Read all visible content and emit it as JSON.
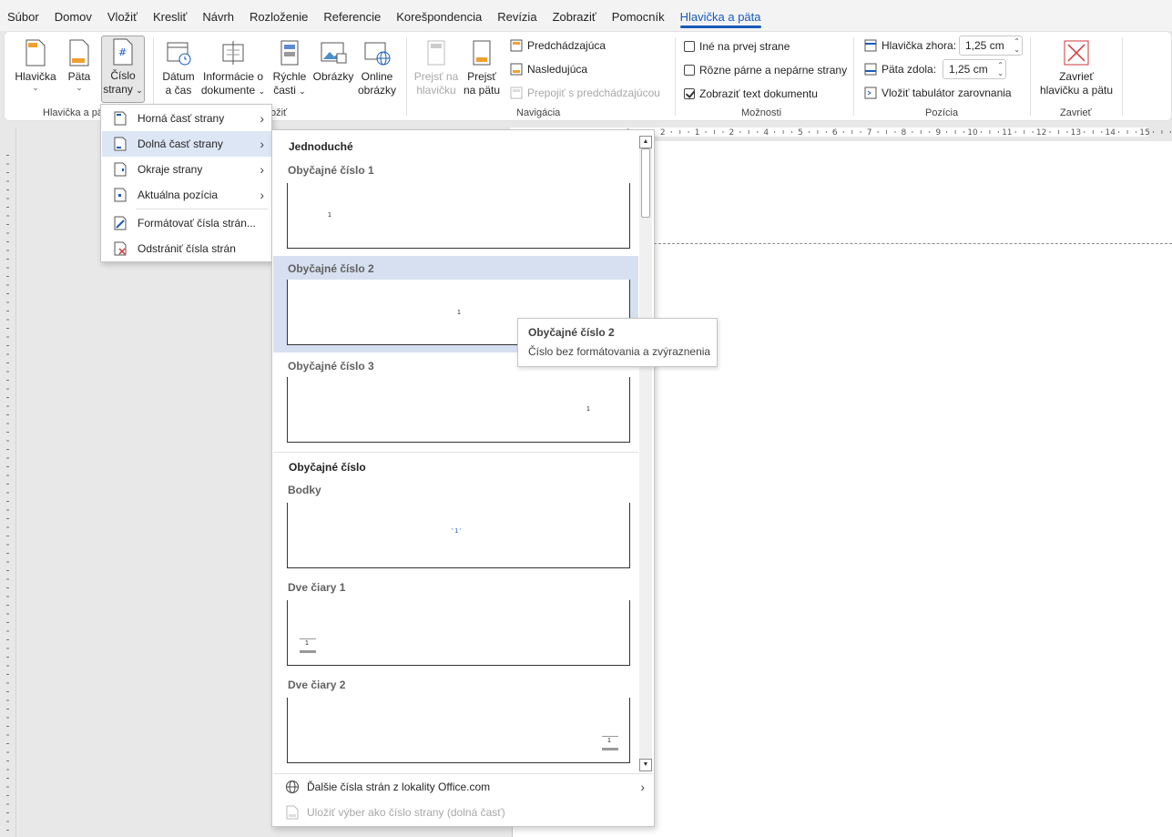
{
  "tabs": [
    "Súbor",
    "Domov",
    "Vložiť",
    "Kresliť",
    "Návrh",
    "Rozloženie",
    "Referencie",
    "Korešpondencia",
    "Revízia",
    "Zobraziť",
    "Pomocník",
    "Hlavička a päta"
  ],
  "ribbon": {
    "header_footer": {
      "group_label": "Hlavička a pä",
      "header_line1": "Hlavička",
      "footer_line1": "Päta",
      "page_number_line1": "Číslo",
      "page_number_line2": "strany"
    },
    "insert": {
      "group_label": "ožiť",
      "date_line1": "Dátum",
      "date_line2": "a čas",
      "docinfo_line1": "Informácie o",
      "docinfo_line2": "dokumente",
      "quick_line1": "Rýchle",
      "quick_line2": "časti",
      "pictures": "Obrázky",
      "online_line1": "Online",
      "online_line2": "obrázky"
    },
    "navigation": {
      "group_label": "Navigácia",
      "goto_header_line1": "Prejsť na",
      "goto_header_line2": "hlavičku",
      "goto_footer_line1": "Prejsť",
      "goto_footer_line2": "na pätu",
      "previous": "Predchádzajúca",
      "next": "Nasledujúca",
      "link_previous": "Prepojiť s predchádzajúcou"
    },
    "options": {
      "group_label": "Možnosti",
      "first_page": "Iné na prvej strane",
      "odd_even": "Rôzne párne a nepárne strany",
      "show_text": "Zobraziť text dokumentu"
    },
    "position": {
      "group_label": "Pozícia",
      "header_top_label": "Hlavička zhora:",
      "header_top_value": "1,25 cm",
      "footer_bottom_label": "Päta zdola:",
      "footer_bottom_value": "1,25 cm",
      "insert_tab": "Vložiť tabulátor zarovnania"
    },
    "close": {
      "group_label": "Zavrieť",
      "close_line1": "Zavrieť",
      "close_line2": "hlavičku a pätu"
    }
  },
  "ruler": [
    "1",
    "2",
    "1",
    "2",
    "4",
    "5",
    "6",
    "7",
    "8",
    "9",
    "10",
    "11",
    "12",
    "13",
    "14",
    "15"
  ],
  "page_number_menu": [
    {
      "label": "Horná časť strany"
    },
    {
      "label": "Dolná časť strany"
    },
    {
      "label": "Okraje strany"
    },
    {
      "label": "Aktuálna pozícia"
    },
    {
      "label": "Formátovať čísla strán..."
    },
    {
      "label": "Odstrániť čísla strán"
    }
  ],
  "gallery": {
    "section1": "Jednoduché",
    "section2": "Obyčajné číslo",
    "items": [
      {
        "title": "Obyčajné číslo 1",
        "num": "1"
      },
      {
        "title": "Obyčajné číslo 2",
        "num": "1"
      },
      {
        "title": "Obyčajné číslo 3",
        "num": "1"
      },
      {
        "title": "Bodky",
        "num": "' 1 '"
      },
      {
        "title": "Dve čiary 1",
        "num": "1"
      },
      {
        "title": "Dve čiary 2",
        "num": "1"
      }
    ],
    "more": "Ďalšie čísla strán z lokality Office.com",
    "save": "Uložiť výber ako číslo strany (dolná časť)"
  },
  "tooltip": {
    "title": "Obyčajné číslo 2",
    "description": "Číslo bez formátovania a zvýraznenia"
  },
  "colors": {
    "accent": "#185abd",
    "highlight": "#d6e0f0",
    "close_red": "#d13438"
  }
}
